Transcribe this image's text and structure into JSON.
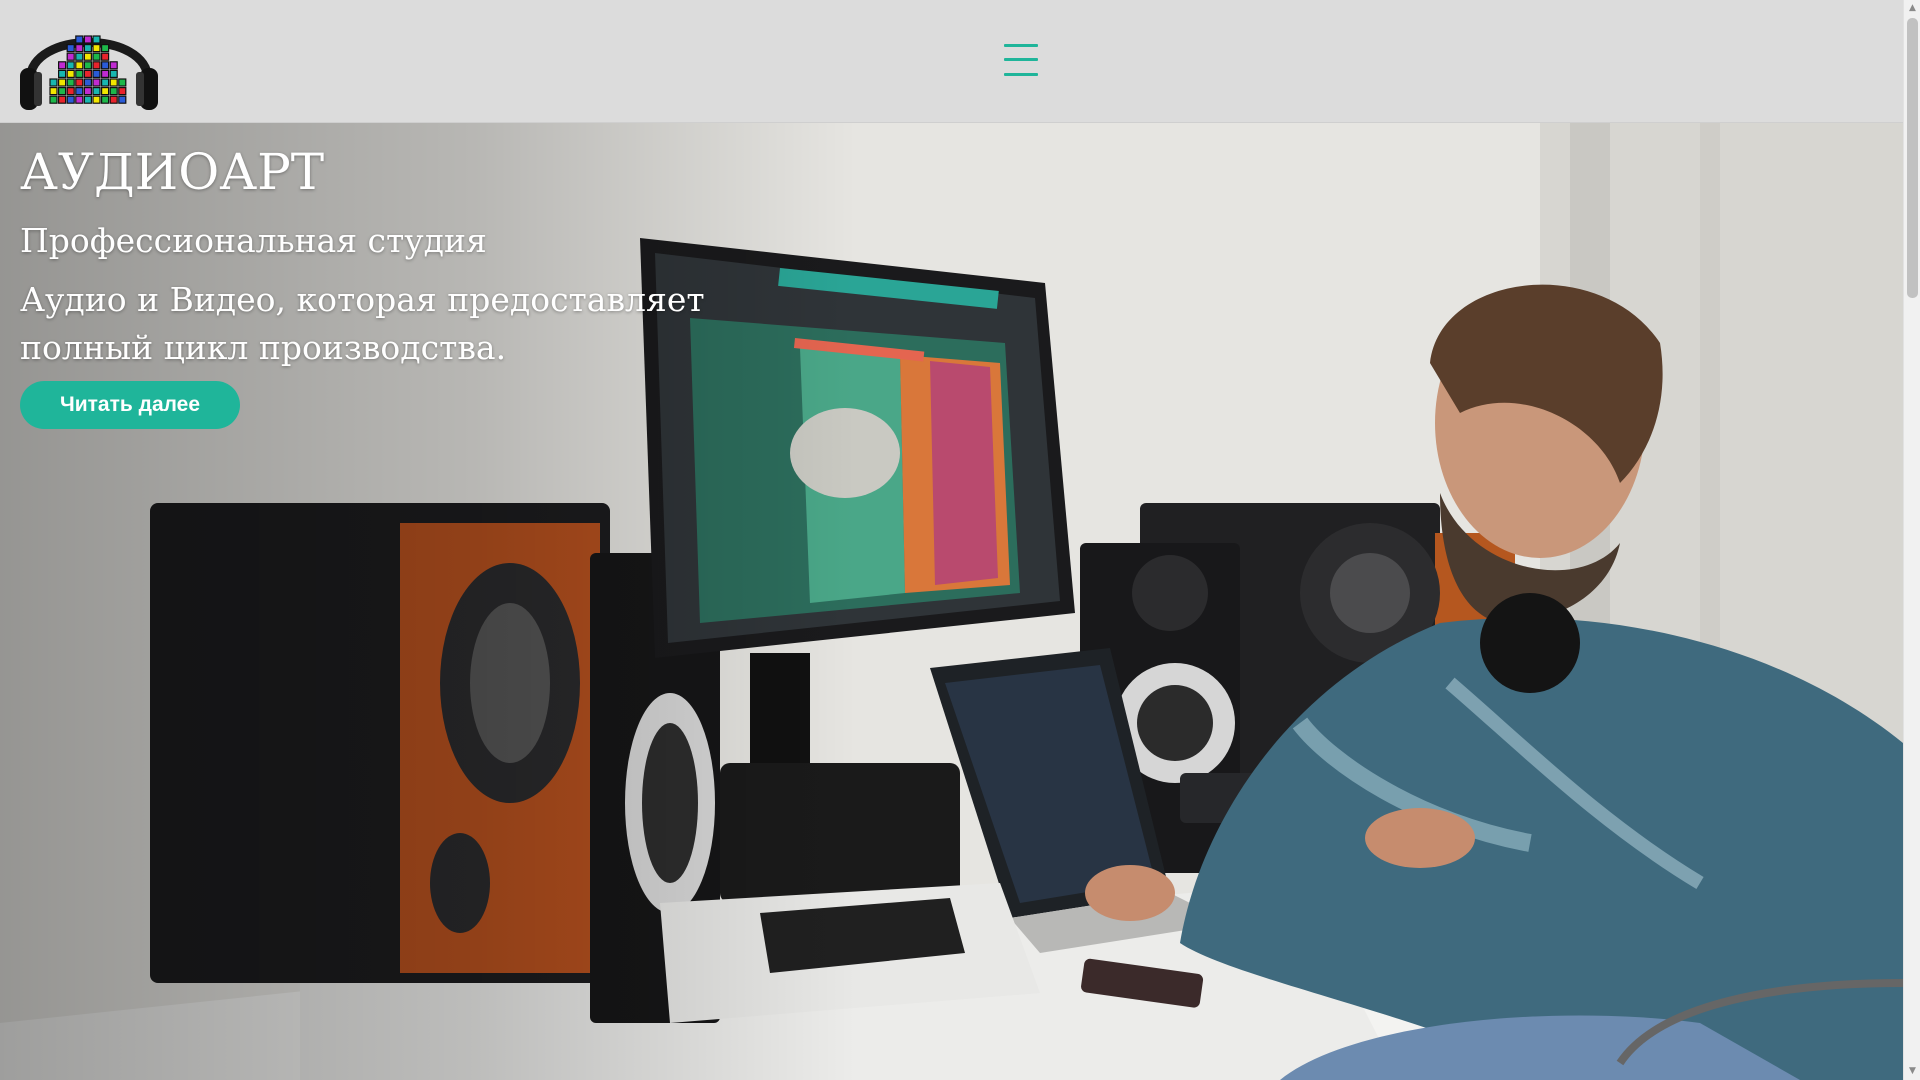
{
  "header": {
    "logo_icon": "headphones-equalizer-logo",
    "menu_icon": "hamburger-menu-icon",
    "accent_color": "#1fb59a"
  },
  "hero": {
    "title": "АУДИОАРТ",
    "subtitle": "Профессиональная студия",
    "description": "Аудио и Видео, которая предоставляет полный цикл производства.",
    "button_label": "Читать далее",
    "background_icon": "studio-photo"
  },
  "scrollbar": {
    "up_icon": "▲",
    "down_icon": "▼"
  }
}
